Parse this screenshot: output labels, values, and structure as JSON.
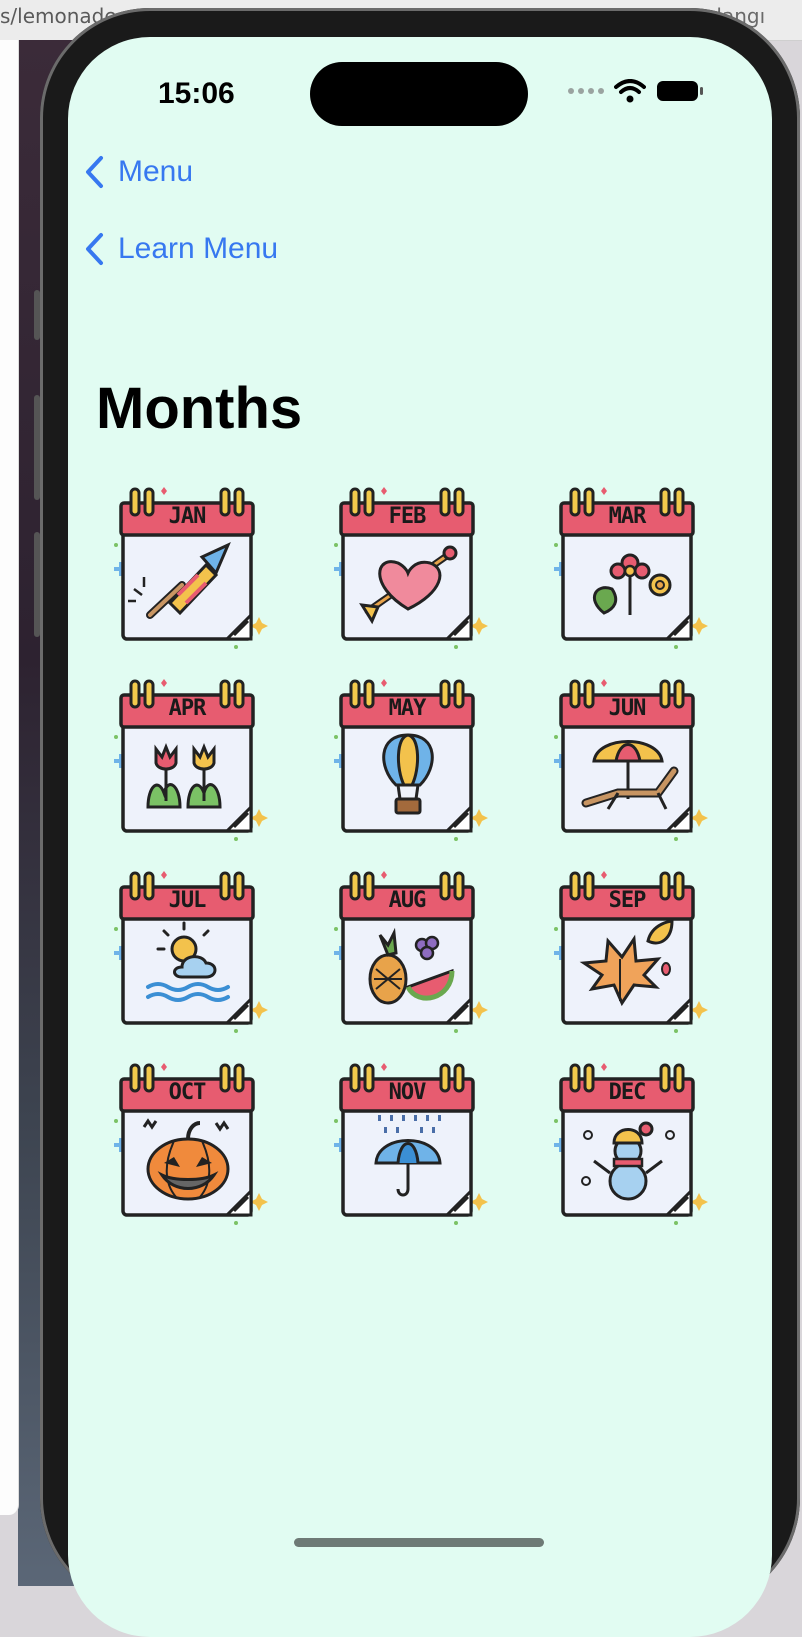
{
  "background": {
    "url_fragment": "s/lemonadee",
    "right_fragment": "Başlangı"
  },
  "status_bar": {
    "time": "15:06"
  },
  "nav": {
    "back_1": "Menu",
    "back_2": "Learn Menu"
  },
  "page": {
    "title": "Months"
  },
  "months": [
    {
      "label": "JAN",
      "icon": "firework-rocket-icon"
    },
    {
      "label": "FEB",
      "icon": "heart-arrow-icon"
    },
    {
      "label": "MAR",
      "icon": "flowers-icon"
    },
    {
      "label": "APR",
      "icon": "tulips-icon"
    },
    {
      "label": "MAY",
      "icon": "hot-air-balloon-icon"
    },
    {
      "label": "JUN",
      "icon": "beach-chair-umbrella-icon"
    },
    {
      "label": "JUL",
      "icon": "sun-sea-icon"
    },
    {
      "label": "AUG",
      "icon": "fruits-icon"
    },
    {
      "label": "SEP",
      "icon": "autumn-leaves-icon"
    },
    {
      "label": "OCT",
      "icon": "pumpkin-icon"
    },
    {
      "label": "NOV",
      "icon": "umbrella-rain-icon"
    },
    {
      "label": "DEC",
      "icon": "snowman-icon"
    }
  ],
  "colors": {
    "accent": "#3778f0",
    "screen_bg": "#e1fcf2",
    "calendar_header": "#e75c70",
    "calendar_body": "#eef2fb",
    "ring": "#f2c94c"
  }
}
